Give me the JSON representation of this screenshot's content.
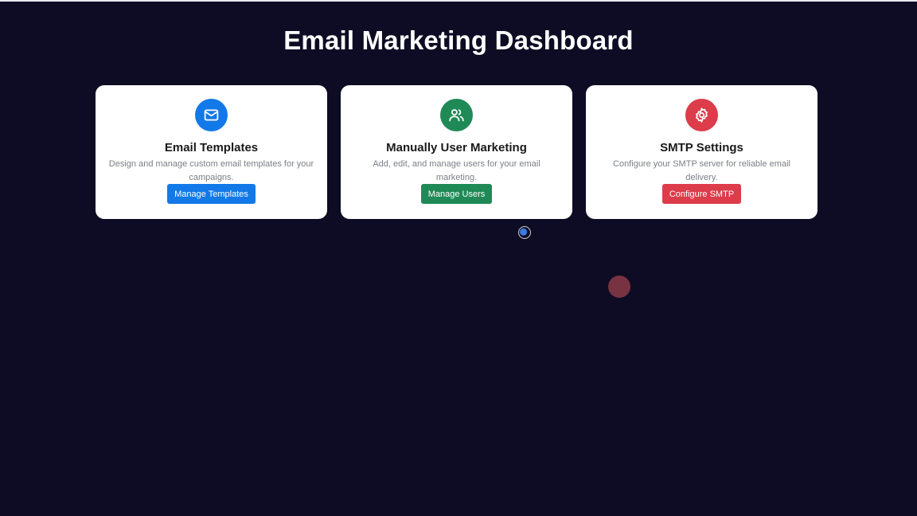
{
  "page": {
    "title": "Email Marketing Dashboard"
  },
  "cards": [
    {
      "icon": "mail-icon",
      "icon_color": "#1479e8",
      "title": "Email Templates",
      "description": "Design and manage custom email templates for your campaigns.",
      "button_label": "Manage Templates",
      "button_color": "#1479e8"
    },
    {
      "icon": "users-icon",
      "icon_color": "#1f8a56",
      "title": "Manually User Marketing",
      "description": "Add, edit, and manage users for your email marketing.",
      "button_label": "Manage Users",
      "button_color": "#1f8a56"
    },
    {
      "icon": "gear-icon",
      "icon_color": "#dd3c4a",
      "title": "SMTP Settings",
      "description": "Configure your SMTP server for reliable email delivery.",
      "button_label": "Configure SMTP",
      "button_color": "#dd3c4a"
    }
  ],
  "colors": {
    "background": "#0e0c24",
    "card": "#ffffff"
  }
}
